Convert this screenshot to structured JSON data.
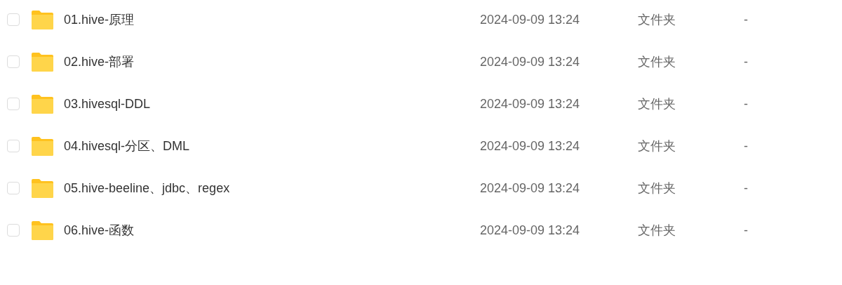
{
  "files": [
    {
      "name": "01.hive-原理",
      "modified": "2024-09-09 13:24",
      "type": "文件夹",
      "size": "-",
      "checked": false
    },
    {
      "name": "02.hive-部署",
      "modified": "2024-09-09 13:24",
      "type": "文件夹",
      "size": "-",
      "checked": false
    },
    {
      "name": "03.hivesql-DDL",
      "modified": "2024-09-09 13:24",
      "type": "文件夹",
      "size": "-",
      "checked": false
    },
    {
      "name": "04.hivesql-分区、DML",
      "modified": "2024-09-09 13:24",
      "type": "文件夹",
      "size": "-",
      "checked": false
    },
    {
      "name": "05.hive-beeline、jdbc、regex",
      "modified": "2024-09-09 13:24",
      "type": "文件夹",
      "size": "-",
      "checked": false
    },
    {
      "name": "06.hive-函数",
      "modified": "2024-09-09 13:24",
      "type": "文件夹",
      "size": "-",
      "checked": false
    }
  ]
}
